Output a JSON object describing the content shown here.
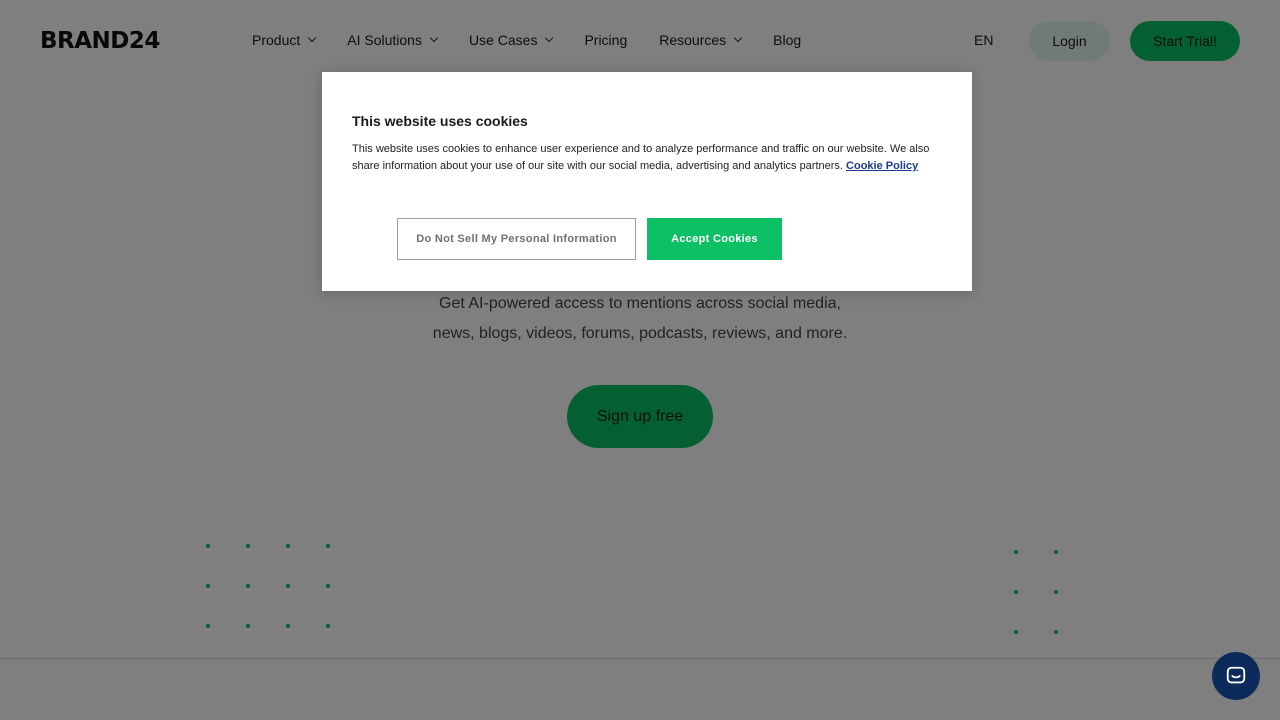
{
  "header": {
    "logo": "BRAND24",
    "nav": [
      {
        "label": "Product",
        "has_dropdown": true
      },
      {
        "label": "AI Solutions",
        "has_dropdown": true
      },
      {
        "label": "Use Cases",
        "has_dropdown": true
      },
      {
        "label": "Pricing",
        "has_dropdown": false
      },
      {
        "label": "Resources",
        "has_dropdown": true
      },
      {
        "label": "Blog",
        "has_dropdown": false
      }
    ],
    "language": "EN",
    "login_label": "Login",
    "trial_label": "Start Trial!"
  },
  "hero": {
    "subtitle_line1": "Get AI-powered access to mentions across social media,",
    "subtitle_line2": "news, blogs, videos, forums, podcasts, reviews, and more.",
    "signup_label": "Sign up free"
  },
  "cookie_banner": {
    "title": "This website uses cookies",
    "text": "This website uses cookies to enhance user experience and to analyze performance and traffic on our website. We also share information about your use of our site with our social media, advertising and analytics partners.",
    "policy_link": "Cookie Policy",
    "do_not_sell_label": "Do Not Sell My Personal Information",
    "accept_label": "Accept Cookies"
  },
  "colors": {
    "brand_green": "#0bc163",
    "overlay": "rgba(0,0,0,0.5)",
    "chat_bg": "#0c2a5a"
  },
  "icons": {
    "chevron": "chevron-down-icon",
    "chat": "chat-icon"
  }
}
